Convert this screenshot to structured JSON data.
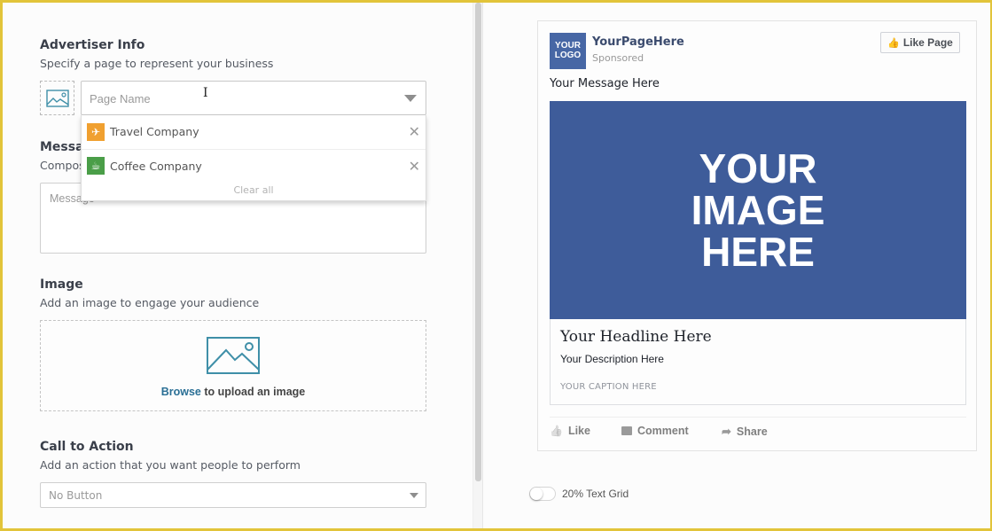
{
  "colors": {
    "frame_border": "#e2c43a",
    "brand_blue": "#3e5c9a",
    "link_blue": "#2a6f95",
    "travel_icon": "#f0a030",
    "coffee_icon": "#4a9e48"
  },
  "advertiser": {
    "title": "Advertiser Info",
    "subtitle": "Specify a page to represent your business",
    "page_name_placeholder": "Page Name",
    "page_name_value": "",
    "dropdown": {
      "items": [
        {
          "label": "Travel Company",
          "icon": "airplane-icon"
        },
        {
          "label": "Coffee Company",
          "icon": "coffee-cup-icon"
        }
      ],
      "clear_all": "Clear all"
    }
  },
  "message": {
    "title": "Message",
    "subtitle": "Compose a message",
    "placeholder": "Message"
  },
  "image": {
    "title": "Image",
    "subtitle": "Add an image to engage your audience",
    "browse_link": "Browse",
    "browse_rest": " to upload an image"
  },
  "cta": {
    "title": "Call to Action",
    "subtitle": "Add an action that you want people to perform",
    "selected": "No Button"
  },
  "preview": {
    "logo_text": "YOUR\nLOGO",
    "page_name": "YourPageHere",
    "sponsored": "Sponsored",
    "like_page": "Like Page",
    "message": "Your Message Here",
    "hero_text": "YOUR\nIMAGE\nHERE",
    "headline": "Your Headline Here",
    "description": "Your Description Here",
    "caption": "YOUR CAPTION HERE",
    "actions": {
      "like": "Like",
      "comment": "Comment",
      "share": "Share"
    }
  },
  "text_grid": {
    "label": "20% Text Grid",
    "enabled": false
  }
}
